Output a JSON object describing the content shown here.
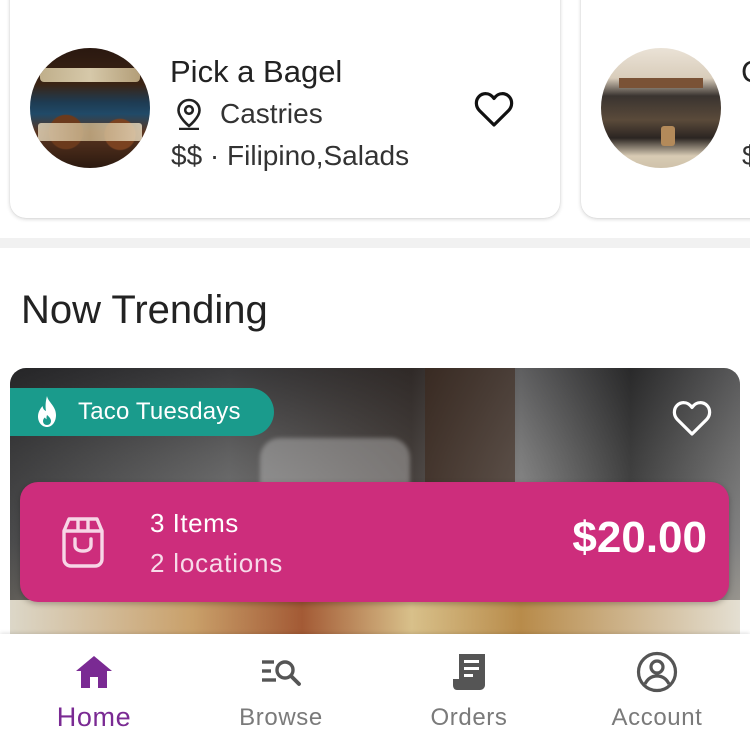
{
  "restaurants": [
    {
      "name": "Pick a Bagel",
      "location": "Castries",
      "price": "$$",
      "cuisines": "Filipino,Salads",
      "meta": "$$ · Filipino,Salads",
      "icon": "heart-outline-icon"
    },
    {
      "name": "C",
      "location": "",
      "price": "$",
      "meta": "$",
      "icon": "heart-outline-icon"
    }
  ],
  "trending": {
    "title": "Now Trending",
    "badge": {
      "label": "Taco Tuesdays",
      "icon": "flame-icon",
      "color": "#1a9b8c"
    },
    "bundle": {
      "items": "3 Items",
      "locations": "2 locations",
      "price": "$20.00",
      "icon": "shopping-bag-icon",
      "color": "#cd2d7c"
    }
  },
  "nav": {
    "items": [
      {
        "label": "Home",
        "icon": "home-icon",
        "active": true
      },
      {
        "label": "Browse",
        "icon": "browse-search-icon",
        "active": false
      },
      {
        "label": "Orders",
        "icon": "receipt-icon",
        "active": false
      },
      {
        "label": "Account",
        "icon": "account-circle-icon",
        "active": false
      }
    ],
    "active_color": "#7a2a93",
    "inactive_color": "#7a7a7a"
  }
}
